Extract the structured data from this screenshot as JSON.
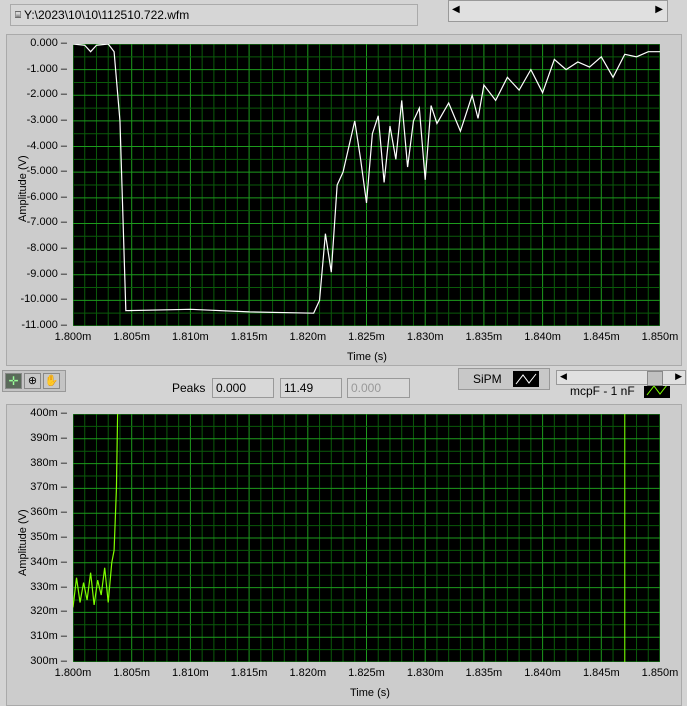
{
  "file_path": "Y:\\2023\\10\\10\\112510.722.wfm",
  "toolbar": {
    "peaks_label": "Peaks",
    "peaks": [
      "0.000",
      "11.49",
      "0.000"
    ]
  },
  "legend": [
    {
      "name": "SiPM",
      "color": "#ffffff"
    },
    {
      "name": "mcpF - 1 nF",
      "color": "#7fff00"
    }
  ],
  "chart_data": [
    {
      "type": "line",
      "xlabel": "Time (s)",
      "ylabel": "Amplitude (V)",
      "xlim": [
        1.8,
        1.85
      ],
      "ylim": [
        -11,
        0
      ],
      "xticks": [
        "1.800m",
        "1.805m",
        "1.810m",
        "1.815m",
        "1.820m",
        "1.825m",
        "1.830m",
        "1.835m",
        "1.840m",
        "1.845m",
        "1.850m"
      ],
      "yticks": [
        "0.000",
        "-1.000",
        "-2.000",
        "-3.000",
        "-4.000",
        "-5.000",
        "-6.000",
        "-7.000",
        "-8.000",
        "-9.000",
        "-10.000",
        "-11.000"
      ],
      "series": [
        {
          "name": "SiPM",
          "color": "#ffffff",
          "x": [
            1.8,
            1.801,
            1.8015,
            1.802,
            1.803,
            1.8035,
            1.804,
            1.8045,
            1.81,
            1.815,
            1.8205,
            1.821,
            1.8215,
            1.822,
            1.8225,
            1.823,
            1.8235,
            1.824,
            1.8245,
            1.825,
            1.8255,
            1.826,
            1.8265,
            1.827,
            1.8275,
            1.828,
            1.8285,
            1.829,
            1.8295,
            1.83,
            1.8305,
            1.831,
            1.832,
            1.833,
            1.834,
            1.8345,
            1.835,
            1.836,
            1.837,
            1.838,
            1.839,
            1.84,
            1.841,
            1.842,
            1.843,
            1.844,
            1.845,
            1.846,
            1.847,
            1.848,
            1.849,
            1.85
          ],
          "y": [
            0,
            -0.05,
            -0.3,
            -0.05,
            0,
            -0.3,
            -3,
            -10.4,
            -10.35,
            -10.45,
            -10.5,
            -10,
            -7.4,
            -8.9,
            -5.5,
            -5,
            -4,
            -3.0,
            -4.5,
            -6.2,
            -3.5,
            -2.8,
            -5.4,
            -3.2,
            -4.5,
            -2.2,
            -4.8,
            -3,
            -2.5,
            -5.3,
            -2.4,
            -3.1,
            -2.3,
            -3.4,
            -2.0,
            -2.9,
            -1.6,
            -2.2,
            -1.3,
            -1.8,
            -1.0,
            -1.9,
            -0.6,
            -1.0,
            -0.7,
            -0.9,
            -0.5,
            -1.3,
            -0.4,
            -0.5,
            -0.3,
            -0.3
          ]
        }
      ]
    },
    {
      "type": "line",
      "xlabel": "Time (s)",
      "ylabel": "Amplitude (V)",
      "xlim": [
        1.8,
        1.85
      ],
      "ylim": [
        300,
        400
      ],
      "xticks": [
        "1.800m",
        "1.805m",
        "1.810m",
        "1.815m",
        "1.820m",
        "1.825m",
        "1.830m",
        "1.835m",
        "1.840m",
        "1.845m",
        "1.850m"
      ],
      "yticks": [
        "400m",
        "390m",
        "380m",
        "370m",
        "360m",
        "350m",
        "340m",
        "330m",
        "320m",
        "310m",
        "300m"
      ],
      "series": [
        {
          "name": "mcpF - 1 nF",
          "color": "#7fff00",
          "x": [
            1.8,
            1.8003,
            1.8006,
            1.8009,
            1.8012,
            1.8015,
            1.8018,
            1.8021,
            1.8024,
            1.8027,
            1.803,
            1.8033,
            1.8035,
            1.8037,
            1.8038
          ],
          "y": [
            322,
            334,
            324,
            332,
            325,
            336,
            323,
            333,
            327,
            338,
            324,
            340,
            345,
            370,
            400
          ]
        }
      ],
      "cursor_x": 1.847
    }
  ]
}
